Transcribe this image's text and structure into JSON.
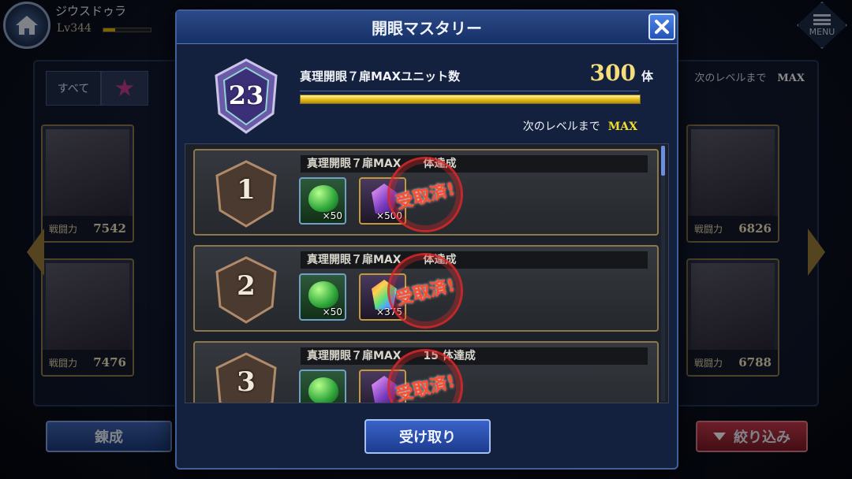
{
  "player": {
    "name": "ジウスドゥラ",
    "level": "Lv344"
  },
  "header": {
    "menu_label": "MENU"
  },
  "filters": {
    "all_label": "すべて"
  },
  "background_side": {
    "next_level_label": "次のレベルまで",
    "next_level_value": "MAX"
  },
  "background_units": [
    {
      "power_label": "戦闘力",
      "power": "7542"
    },
    {
      "power_label": "戦闘力",
      "power": "7476"
    },
    {
      "power_label": "戦闘力",
      "power": "6826"
    },
    {
      "power_label": "戦闘力",
      "power": "6788"
    }
  ],
  "bottom_bar": {
    "train_label": "錬成",
    "filter_label": "絞り込み"
  },
  "modal": {
    "title": "開眼マスタリー",
    "rank": "23",
    "mastery_title": "真理開眼７扉MAXユニット数",
    "mastery_count": "300",
    "mastery_unit": "体",
    "progress": 1.0,
    "next_level_label": "次のレベルまで",
    "next_level_value": "MAX",
    "receive_label": "受け取り",
    "rewards": [
      {
        "rank": "1",
        "condition": "真理開眼７扉MAX　　体達成",
        "items": [
          {
            "qty": "×50"
          },
          {
            "qty": "×500"
          }
        ],
        "stamp": "受取済!"
      },
      {
        "rank": "2",
        "condition": "真理開眼７扉MAX　　体達成",
        "items": [
          {
            "qty": "×50"
          },
          {
            "qty": "×375"
          }
        ],
        "stamp": "受取済!"
      },
      {
        "rank": "3",
        "condition": "真理開眼７扉MAX　　15 体達成",
        "items": [
          {
            "qty": ""
          },
          {
            "qty": ""
          }
        ],
        "stamp": "受取済!"
      }
    ]
  },
  "colors": {
    "accent_gold": "#f4dd7a",
    "stamp_red": "#ff4b2e",
    "modal_blue": "#14213e"
  }
}
